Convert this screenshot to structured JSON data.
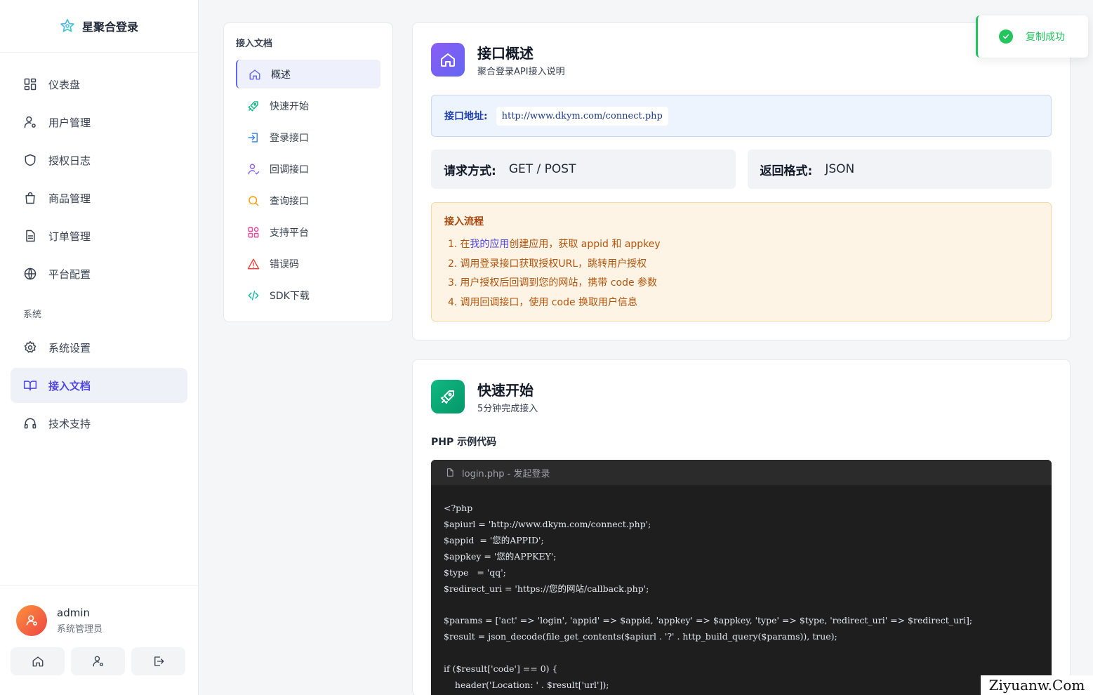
{
  "brand": {
    "title": "星聚合登录"
  },
  "sidebar": {
    "items": [
      {
        "label": "仪表盘",
        "icon": "dashboard-icon"
      },
      {
        "label": "用户管理",
        "icon": "user-gear-icon"
      },
      {
        "label": "授权日志",
        "icon": "shield-icon"
      },
      {
        "label": "商品管理",
        "icon": "shopping-bag-icon"
      },
      {
        "label": "订单管理",
        "icon": "document-icon"
      },
      {
        "label": "平台配置",
        "icon": "globe-icon"
      }
    ],
    "section_label": "系统",
    "system_items": [
      {
        "label": "系统设置",
        "icon": "gear-icon"
      },
      {
        "label": "接入文档",
        "icon": "book-icon",
        "active": true
      },
      {
        "label": "技术支持",
        "icon": "headset-icon"
      }
    ]
  },
  "user": {
    "name": "admin",
    "role": "系统管理员"
  },
  "docnav": {
    "title": "接入文档",
    "items": [
      {
        "label": "概述",
        "icon": "home-icon",
        "active": true
      },
      {
        "label": "快速开始",
        "icon": "rocket-icon"
      },
      {
        "label": "登录接口",
        "icon": "login-icon"
      },
      {
        "label": "回调接口",
        "icon": "user-callback-icon"
      },
      {
        "label": "查询接口",
        "icon": "search-icon"
      },
      {
        "label": "支持平台",
        "icon": "grid-icon"
      },
      {
        "label": "错误码",
        "icon": "warning-icon"
      },
      {
        "label": "SDK下载",
        "icon": "code-icon"
      }
    ]
  },
  "overview": {
    "title": "接口概述",
    "subtitle": "聚合登录API接入说明",
    "api_label": "接口地址:",
    "api_url": "http://www.dkym.com/connect.php",
    "method_label": "请求方式:",
    "method_value": "GET / POST",
    "format_label": "返回格式:",
    "format_value": "JSON",
    "flow_title": "接入流程",
    "flow": {
      "s1_num": "1.",
      "s1_pre": "在",
      "s1_link": "我的应用",
      "s1_post": "创建应用，获取 appid 和 appkey",
      "s2_num": "2.",
      "s2": "调用登录接口获取授权URL，跳转用户授权",
      "s3_num": "3.",
      "s3": "用户授权后回调到您的网站，携带 code 参数",
      "s4_num": "4.",
      "s4": "调用回调接口，使用 code 换取用户信息"
    }
  },
  "quickstart": {
    "title": "快速开始",
    "subtitle": "5分钟完成接入",
    "section_label": "PHP 示例代码",
    "code_filename": "login.php - 发起登录",
    "code": "<?php\n$apiurl = 'http://www.dkym.com/connect.php';\n$appid  = '您的APPID';\n$appkey = '您的APPKEY';\n$type   = 'qq';\n$redirect_uri = 'https://您的网站/callback.php';\n\n$params = ['act' => 'login', 'appid' => $appid, 'appkey' => $appkey, 'type' => $type, 'redirect_uri' => $redirect_uri];\n$result = json_decode(file_get_contents($apiurl . '?' . http_build_query($params)), true);\n\nif ($result['code'] == 0) {\n    header('Location: ' . $result['url']);"
  },
  "toast": {
    "text": "复制成功"
  },
  "watermark": {
    "text": "Ziyuanw.Com"
  }
}
